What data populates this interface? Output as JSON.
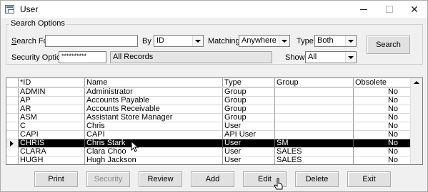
{
  "window": {
    "title": "User"
  },
  "search_options": {
    "group_label": "Search Options",
    "search_for_label": "Search For",
    "search_for_value": "",
    "by_label": "By",
    "by_value": "ID",
    "matching_label": "Matching",
    "matching_value": "Anywhere",
    "type_label": "Type",
    "type_value": "Both",
    "security_option_label": "Security Option",
    "security_option_value": "**********",
    "records_value": "All Records",
    "show_label": "Show",
    "show_value": "All",
    "search_button": "Search"
  },
  "grid": {
    "columns": [
      "*ID",
      "Name",
      "Type",
      "Group",
      "Obsolete"
    ],
    "rows": [
      {
        "id": "ADMIN",
        "name": "Administrator",
        "type": "Group",
        "group": "",
        "obsolete": "No"
      },
      {
        "id": "AP",
        "name": "Accounts Payable",
        "type": "Group",
        "group": "",
        "obsolete": "No"
      },
      {
        "id": "AR",
        "name": "Accounts Receivable",
        "type": "Group",
        "group": "",
        "obsolete": "No"
      },
      {
        "id": "ASM",
        "name": "Assistant Store Manager",
        "type": "Group",
        "group": "",
        "obsolete": "No"
      },
      {
        "id": "C",
        "name": "Chris",
        "type": "User",
        "group": "",
        "obsolete": "No"
      },
      {
        "id": "CAPI",
        "name": "CAPI",
        "type": "API User",
        "group": "",
        "obsolete": "No"
      },
      {
        "id": "CHRIS",
        "name": "Chris Stark",
        "type": "User",
        "group": "SM",
        "obsolete": "No",
        "selected": true
      },
      {
        "id": "CLARA",
        "name": "Clara Choo",
        "type": "User",
        "group": "SALES",
        "obsolete": "No"
      },
      {
        "id": "HUGH",
        "name": "Hugh Jackson",
        "type": "User",
        "group": "SALES",
        "obsolete": "No"
      }
    ]
  },
  "buttons": {
    "print": "Print",
    "security": "Security",
    "review": "Review",
    "add": "Add",
    "edit": "Edit",
    "delete": "Delete",
    "exit": "Exit"
  },
  "colors": {
    "selected_row_bg": "#000000",
    "selected_row_fg": "#ffffff",
    "dialog_bg": "#f0f0f0"
  }
}
